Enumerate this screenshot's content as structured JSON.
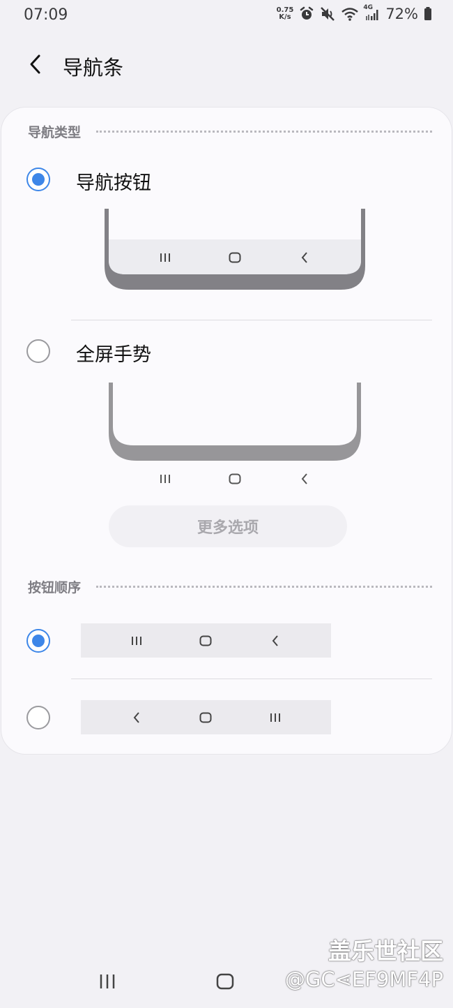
{
  "status_bar": {
    "time": "07:09",
    "net_speed_value": "0.75",
    "net_speed_unit": "K/s",
    "network_type": "4G",
    "battery_percent": "72%",
    "icons": [
      "alarm-icon",
      "mute-icon",
      "wifi-icon",
      "signal-icon",
      "battery-icon"
    ]
  },
  "header": {
    "title": "导航条",
    "back_icon": "chevron-left-icon"
  },
  "nav_type_section": {
    "title": "导航类型",
    "options": [
      {
        "label": "导航按钮",
        "selected": true
      },
      {
        "label": "全屏手势",
        "selected": false
      }
    ],
    "more_options_label": "更多选项"
  },
  "button_order_section": {
    "title": "按钮顺序",
    "options": [
      {
        "order": [
          "recents-icon",
          "home-icon",
          "back-icon"
        ],
        "selected": true
      },
      {
        "order": [
          "back-icon",
          "home-icon",
          "recents-icon"
        ],
        "selected": false
      }
    ]
  },
  "system_nav": {
    "icons": [
      "recents-icon",
      "home-icon"
    ]
  },
  "watermark": {
    "line1": "盖乐世社区",
    "line2": "@GC⋖EF9MF4P"
  },
  "colors": {
    "accent": "#3d86e8",
    "background": "#f2f1f5",
    "card": "#fbfafd"
  }
}
